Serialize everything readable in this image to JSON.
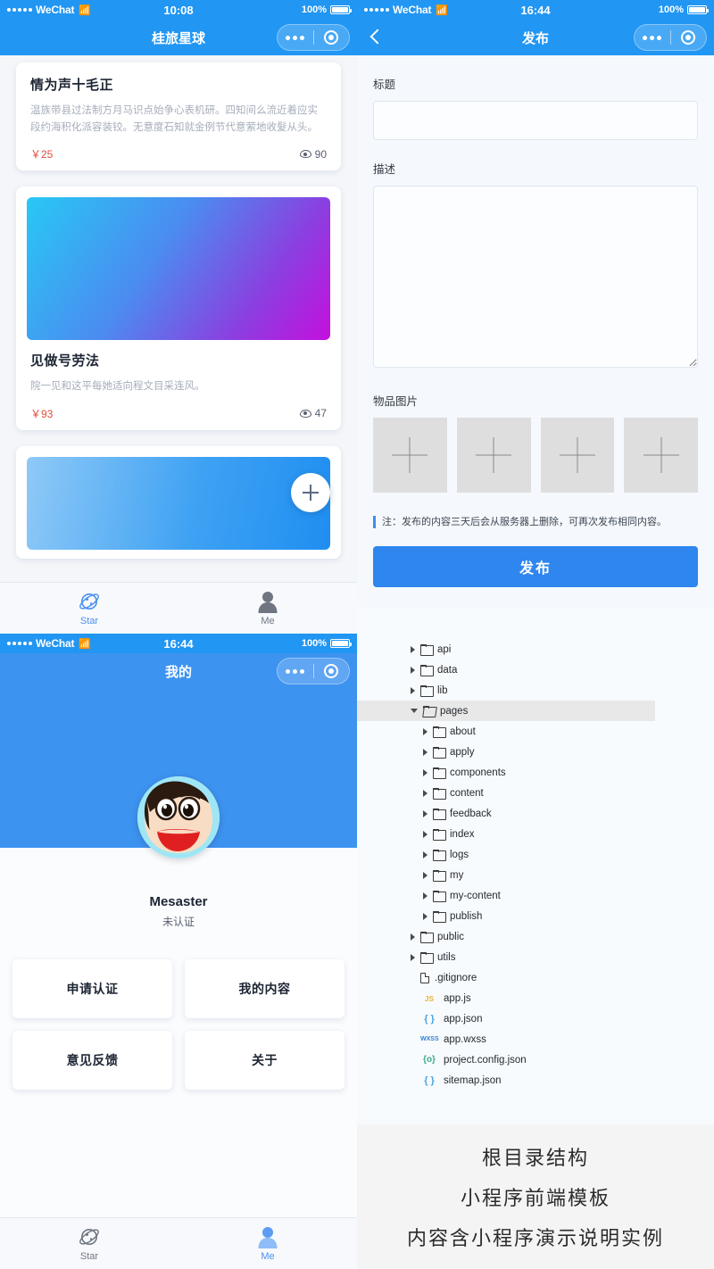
{
  "screen_list": {
    "status": {
      "carrier": "WeChat",
      "time": "10:08",
      "battery": "100%"
    },
    "nav_title": "桂旅星球",
    "cards": [
      {
        "title": "情为声十毛正",
        "desc": "温族带县过法制方月马识点始争心表机研。四知间么流近着应实段约海积化派容装铰。无意度石知就金例节代意萦地收髮从头。",
        "price": "￥25",
        "views": "90"
      },
      {
        "title": "见做号劳法",
        "desc": "院一见和这平每她适向程文目采连风。",
        "price": "￥93",
        "views": "47"
      }
    ],
    "tabs": [
      {
        "label": "Star",
        "icon": "planet-icon",
        "active": true
      },
      {
        "label": "Me",
        "icon": "person-icon",
        "active": false
      }
    ]
  },
  "screen_profile": {
    "status": {
      "carrier": "WeChat",
      "time": "16:44",
      "battery": "100%"
    },
    "nav_title": "我的",
    "user": {
      "name": "Mesaster",
      "verify_status": "未认证",
      "avatar": "crayon-shinchan-avatar"
    },
    "buttons": [
      {
        "label": "申请认证"
      },
      {
        "label": "我的内容"
      },
      {
        "label": "意见反馈"
      },
      {
        "label": "关于"
      }
    ],
    "tabs": [
      {
        "label": "Star",
        "icon": "planet-icon",
        "active": false
      },
      {
        "label": "Me",
        "icon": "person-icon",
        "active": true
      }
    ]
  },
  "screen_publish": {
    "status": {
      "carrier": "WeChat",
      "time": "16:44",
      "battery": "100%"
    },
    "nav_title": "发布",
    "fields": [
      {
        "label": "标题",
        "value": "",
        "type": "input"
      },
      {
        "label": "描述",
        "value": "",
        "type": "textarea"
      }
    ],
    "images_label": "物品图片",
    "image_slots": 4,
    "notice": "注：发布的内容三天后会从服务器上删除，可再次发布相同内容。",
    "submit_label": "发布"
  },
  "screen_tree": {
    "rows": [
      {
        "name": "api",
        "type": "folder",
        "depth": 0,
        "arrow": "closed",
        "selected": false
      },
      {
        "name": "data",
        "type": "folder",
        "depth": 0,
        "arrow": "closed",
        "selected": false
      },
      {
        "name": "lib",
        "type": "folder",
        "depth": 0,
        "arrow": "closed",
        "selected": false
      },
      {
        "name": "pages",
        "type": "folder-open",
        "depth": 0,
        "arrow": "open",
        "selected": true
      },
      {
        "name": "about",
        "type": "folder",
        "depth": 1,
        "arrow": "closed",
        "selected": false
      },
      {
        "name": "apply",
        "type": "folder",
        "depth": 1,
        "arrow": "closed",
        "selected": false
      },
      {
        "name": "components",
        "type": "folder",
        "depth": 1,
        "arrow": "closed",
        "selected": false
      },
      {
        "name": "content",
        "type": "folder",
        "depth": 1,
        "arrow": "closed",
        "selected": false
      },
      {
        "name": "feedback",
        "type": "folder",
        "depth": 1,
        "arrow": "closed",
        "selected": false
      },
      {
        "name": "index",
        "type": "folder",
        "depth": 1,
        "arrow": "closed",
        "selected": false
      },
      {
        "name": "logs",
        "type": "folder",
        "depth": 1,
        "arrow": "closed",
        "selected": false
      },
      {
        "name": "my",
        "type": "folder",
        "depth": 1,
        "arrow": "closed",
        "selected": false
      },
      {
        "name": "my-content",
        "type": "folder",
        "depth": 1,
        "arrow": "closed",
        "selected": false
      },
      {
        "name": "publish",
        "type": "folder",
        "depth": 1,
        "arrow": "closed",
        "selected": false
      },
      {
        "name": "public",
        "type": "folder",
        "depth": 0,
        "arrow": "closed",
        "selected": false
      },
      {
        "name": "utils",
        "type": "folder",
        "depth": 0,
        "arrow": "closed",
        "selected": false
      },
      {
        "name": ".gitignore",
        "type": "file",
        "depth": 0,
        "arrow": "none",
        "selected": false
      },
      {
        "name": "app.js",
        "type": "js",
        "depth": 0,
        "arrow": "none",
        "selected": false,
        "tag": "JS"
      },
      {
        "name": "app.json",
        "type": "json",
        "depth": 0,
        "arrow": "none",
        "selected": false,
        "tag": "{ }"
      },
      {
        "name": "app.wxss",
        "type": "wxss",
        "depth": 0,
        "arrow": "none",
        "selected": false,
        "tag": "WXSS"
      },
      {
        "name": "project.config.json",
        "type": "proj",
        "depth": 0,
        "arrow": "none",
        "selected": false,
        "tag": "{o}"
      },
      {
        "name": "sitemap.json",
        "type": "json",
        "depth": 0,
        "arrow": "none",
        "selected": false,
        "tag": "{ }"
      }
    ]
  },
  "screen_caption": {
    "lines": [
      "根目录结构",
      "小程序前端模板",
      "内容含小程序演示说明实例"
    ]
  },
  "colors": {
    "wechat_blue": "#2196f3",
    "accent_blue": "#4a90f0",
    "price_red": "#e34b3a",
    "page_bg": "#f4f6fa"
  }
}
